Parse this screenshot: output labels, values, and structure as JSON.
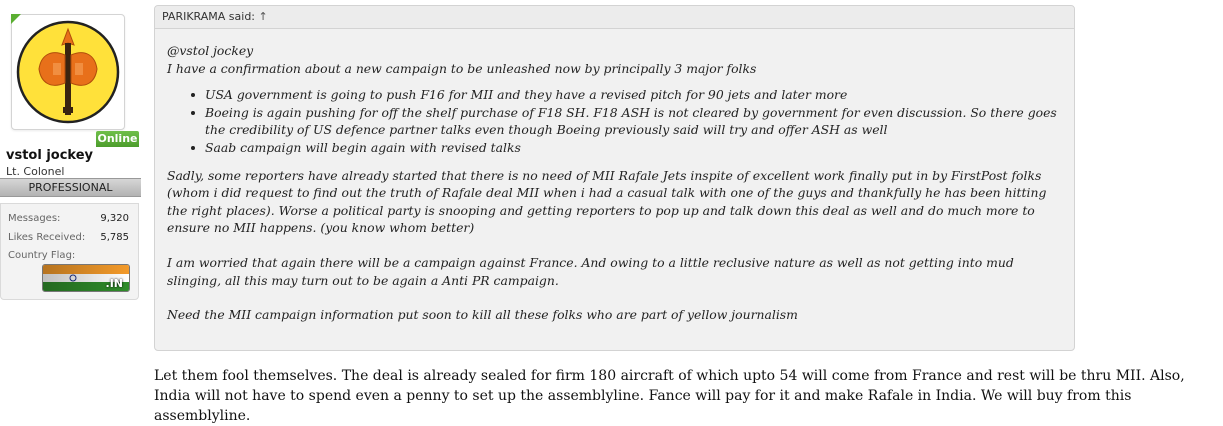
{
  "user": {
    "name": "vstol jockey",
    "title": "Lt. Colonel",
    "rank": "PROFESSIONAL",
    "online_label": "Online",
    "stats": [
      {
        "label": "Messages:",
        "value": "9,320"
      },
      {
        "label": "Likes Received:",
        "value": "5,785"
      }
    ],
    "country_label": "Country Flag:",
    "country_code": ".IN",
    "avatar_icon": "axe-emblem-icon",
    "colors": {
      "online": "#4c9d2c",
      "avatar_fill": "#ffe13a"
    }
  },
  "quote": {
    "author_line": "PARIKRAMA said:",
    "arrow": "↑",
    "mention": "@vstol jockey",
    "intro": "I have a confirmation about a new campaign to be unleashed now by principally 3 major folks",
    "bullets": [
      "USA government is going to push F16 for MII and they have a revised pitch for 90 jets and later more",
      "Boeing is again pushing for off the shelf purchase of F18 SH. F18 ASH is not cleared by government for even discussion. So there goes the credibility of US defence partner talks even though Boeing previously said will try and offer ASH as well",
      "Saab campaign will begin again with revised talks"
    ],
    "para1": "Sadly, some reporters have already started that there is no need of MII Rafale Jets inspite of excellent work finally put in by FirstPost folks (whom i did request to find out the truth of Rafale deal MII when i had a casual talk with one of the guys and thankfully he has been hitting the right places). Worse a political party is snooping and getting reporters to pop up and talk down this deal as well and do much more to ensure no MII happens. (you know whom better)",
    "para2": "I am worried that again there will be a campaign against France. And owing to a little reclusive nature as well as not getting into mud slinging, all this may turn out to be again a Anti PR campaign.",
    "para3": "Need the MII campaign information put soon to kill all these folks who are part of yellow journalism"
  },
  "reply": {
    "text": "Let them fool themselves. The deal is already sealed for firm 180 aircraft of which upto 54 will come from France and rest will be thru MII. Also, India will not have to spend even a penny to set up the assemblyline. Fance will pay for it and make Rafale in India. We will buy from this assemblyline."
  }
}
